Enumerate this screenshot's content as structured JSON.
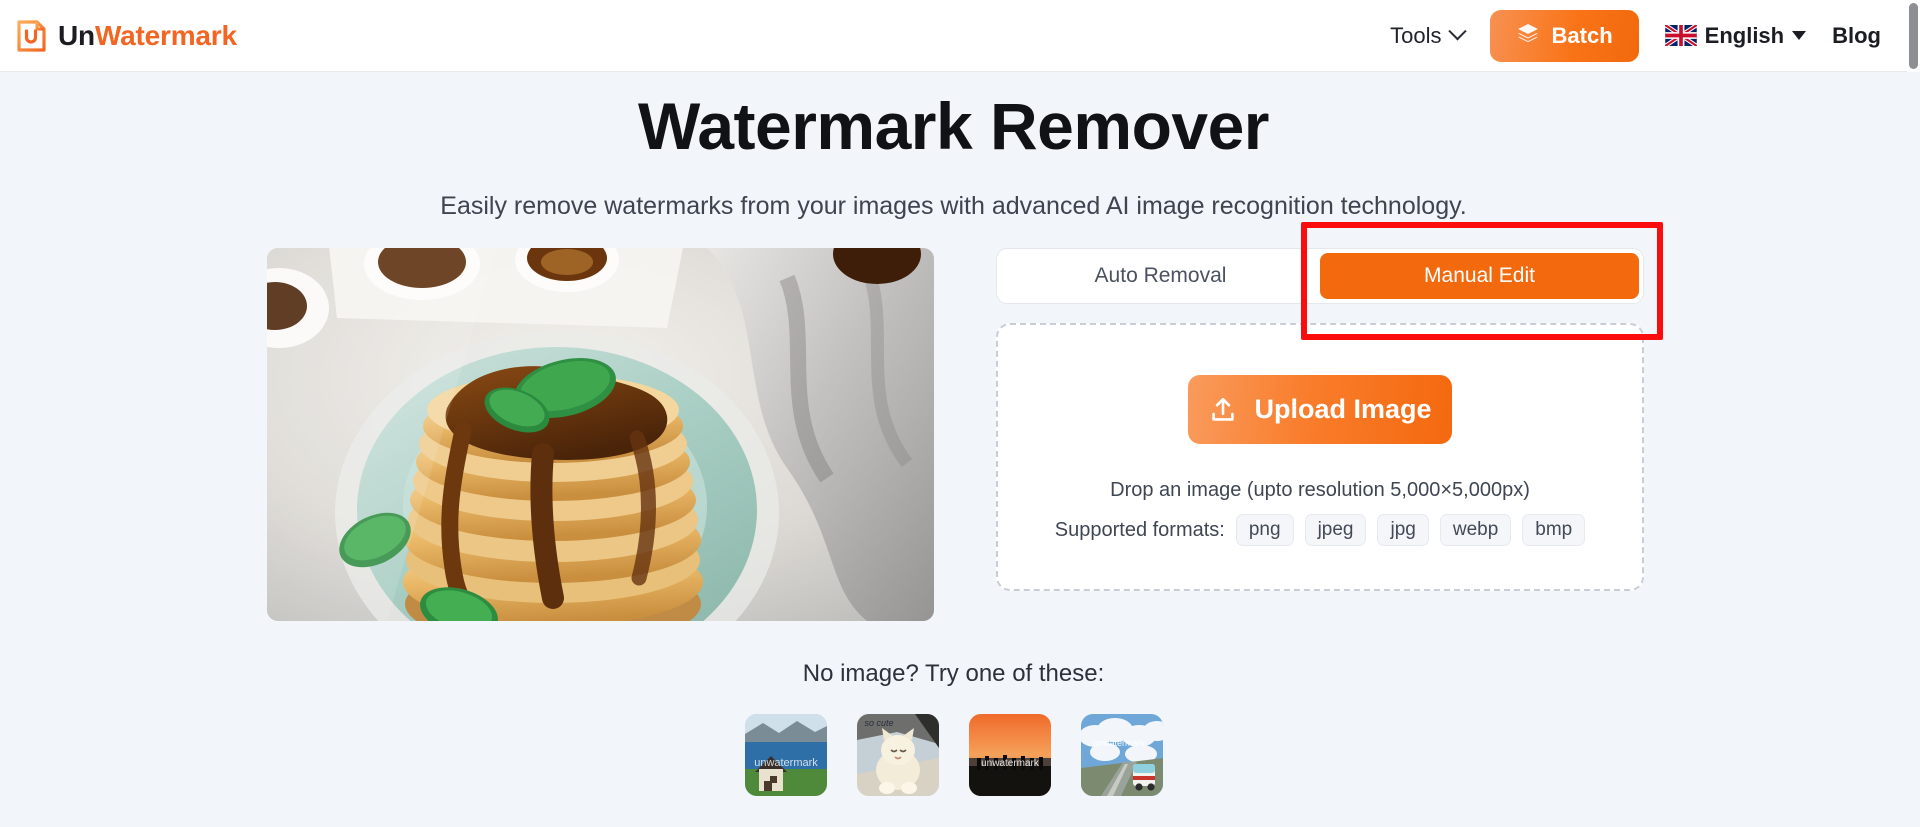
{
  "header": {
    "brand": {
      "name_prefix": "Un",
      "name_suffix": "Watermark",
      "logo_icon": "document-u-logo-icon"
    },
    "nav": {
      "tools_label": "Tools",
      "tools_chevron_icon": "chevron-down-icon",
      "batch_label": "Batch",
      "batch_icon": "layers-stack-icon",
      "language_label": "English",
      "language_flag_icon": "uk-flag-icon",
      "language_caret_icon": "caret-down-icon",
      "blog_label": "Blog"
    }
  },
  "hero": {
    "title": "Watermark Remover",
    "subtitle": "Easily remove watermarks from your images with advanced AI image recognition technology."
  },
  "preview": {
    "alt": "pancake-stack-preview-image"
  },
  "modes": {
    "tabs": [
      {
        "label": "Auto Removal",
        "active": false
      },
      {
        "label": "Manual Edit",
        "active": true
      }
    ]
  },
  "dropzone": {
    "upload_button_label": "Upload Image",
    "upload_icon": "upload-arrow-icon",
    "drop_hint": "Drop an image (upto resolution 5,000×5,000px)",
    "formats_label": "Supported formats:",
    "formats": [
      "png",
      "jpeg",
      "jpg",
      "webp",
      "bmp"
    ]
  },
  "samples": {
    "title": "No image? Try one of these:",
    "items": [
      {
        "name": "sample-house-coast",
        "watermark_text": "unwatermark"
      },
      {
        "name": "sample-cat",
        "watermark_text": "so cute"
      },
      {
        "name": "sample-sunset-silhouette",
        "watermark_text": "unwatermark"
      },
      {
        "name": "sample-bus-road",
        "watermark_text": "unwatermark"
      }
    ]
  },
  "annotation": {
    "highlight_color": "#fb0d0d",
    "target": "Manual Edit"
  },
  "colors": {
    "brand_orange": "#f26522",
    "page_background": "#f2f5f9",
    "header_background": "#ffffff",
    "active_tab": "#f2690e"
  },
  "scrollbar": {
    "name": "vertical-scrollbar"
  }
}
